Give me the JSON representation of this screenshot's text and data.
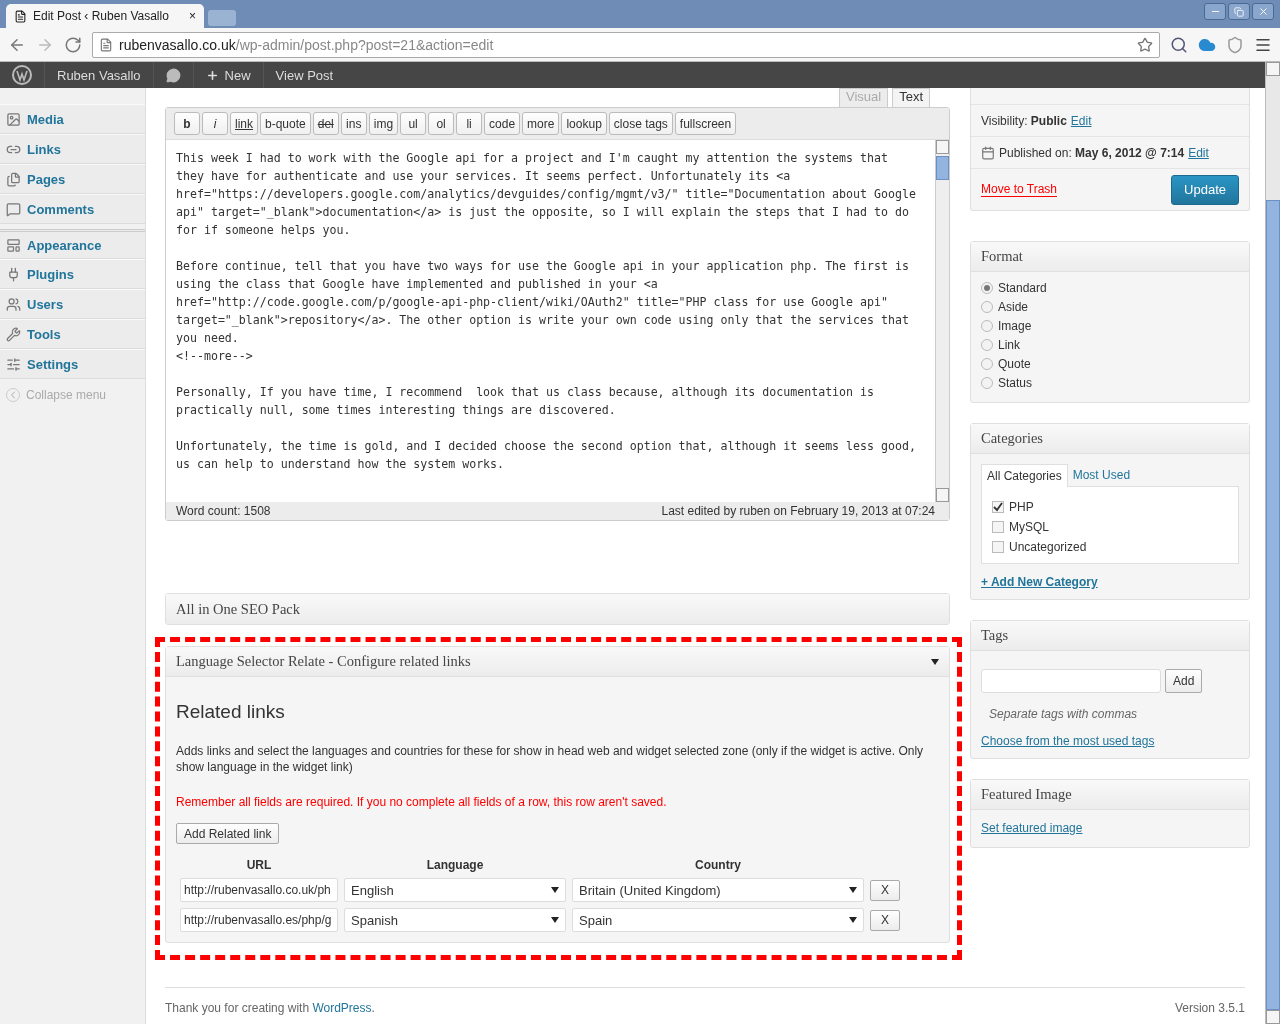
{
  "browser": {
    "tabs": [
      {
        "title": "Edit Post ‹ Ruben Vasallo",
        "close": "×",
        "selected": true
      }
    ],
    "url": {
      "host": "rubenvasallo.co.uk",
      "path": "/wp-admin/post.php?post=21&action=edit"
    }
  },
  "admin_bar": {
    "site": "Ruben Vasallo",
    "new": "New",
    "view": "View Post"
  },
  "sidebar": {
    "groups": [
      [
        {
          "label": "Media"
        },
        {
          "label": "Links"
        },
        {
          "label": "Pages"
        },
        {
          "label": "Comments"
        }
      ],
      [
        {
          "label": "Appearance"
        },
        {
          "label": "Plugins"
        },
        {
          "label": "Users"
        },
        {
          "label": "Tools"
        },
        {
          "label": "Settings"
        }
      ]
    ],
    "collapse": "Collapse menu"
  },
  "editor": {
    "tabs": [
      {
        "label": "Visual",
        "selected": false
      },
      {
        "label": "Text",
        "selected": true
      }
    ],
    "quicktags": [
      {
        "label": "b",
        "kind": "bold"
      },
      {
        "label": "i",
        "kind": "italic"
      },
      {
        "label": "link",
        "kind": "underline"
      },
      {
        "label": "b-quote",
        "kind": "plain"
      },
      {
        "label": "del",
        "kind": "strike"
      },
      {
        "label": "ins",
        "kind": "plain"
      },
      {
        "label": "img",
        "kind": "plain"
      },
      {
        "label": "ul",
        "kind": "plain"
      },
      {
        "label": "ol",
        "kind": "plain"
      },
      {
        "label": "li",
        "kind": "plain"
      },
      {
        "label": "code",
        "kind": "plain"
      },
      {
        "label": "more",
        "kind": "plain"
      },
      {
        "label": "lookup",
        "kind": "plain"
      },
      {
        "label": "close tags",
        "kind": "plain"
      },
      {
        "label": "fullscreen",
        "kind": "plain"
      }
    ],
    "paragraphs": [
      [
        "This week I had to work with the Google api for a project and I'm caught my attention the systems that",
        "they have for authenticate and use your services. It seems perfect. Unfortunately its <a",
        "href=\"https://developers.google.com/analytics/devguides/config/mgmt/v3/\" title=\"Documentation about Google",
        "api\" target=\"_blank\">documentation</a> is just the opposite, so I will explain the steps that I had to do",
        "for if someone helps you."
      ],
      [
        "Before continue, tell that you have two ways for use the Google api in your application php. The first is",
        "using the class that Google have implemented and published in your <a",
        "href=\"http://code.google.com/p/google-api-php-client/wiki/OAuth2\" title=\"PHP class for use Google api\"",
        "target=\"_blank\">repository</a>. The other option is write your own code using only that the services that",
        "you need.",
        "<!--more-->"
      ],
      [
        "Personally, If you have time, I recommend  look that us class because, although its documentation is",
        "practically null, some times interesting things are discovered."
      ],
      [
        "Unfortunately, the time is gold, and I decided choose the second option that, although it seems less good,",
        "us can help to understand how the system works."
      ]
    ],
    "word_count": "Word count: 1508",
    "last_edited": "Last edited by ruben on February 19, 2013 at 07:24"
  },
  "seo_panel": {
    "title": "All in One SEO Pack"
  },
  "language_panel": {
    "title": "Language Selector Relate - Configure related links",
    "heading": "Related links",
    "description": "Adds links and select the languages and countries for these for show in head web and widget selected zone (only if the widget is active. Only show language in the widget link)",
    "warning": "Remember all fields are required. If you no complete all fields of a row, this row aren't saved.",
    "add_button": "Add Related link",
    "columns": [
      "URL",
      "Language",
      "Country"
    ],
    "rows": [
      {
        "url": "http://rubenvasallo.co.uk/ph",
        "language": "English",
        "country": "Britain (United Kingdom)",
        "remove": "X"
      },
      {
        "url": "http://rubenvasallo.es/php/g",
        "language": "Spanish",
        "country": "Spain",
        "remove": "X"
      }
    ]
  },
  "publish": {
    "visibility": "Visibility: **Public**",
    "visibility_edit": "Edit",
    "published": "Published on: **May 6, 2012 @ 7:14**",
    "published_edit": "Edit",
    "trash": "Move to Trash",
    "update": "Update"
  },
  "format": {
    "title": "Format",
    "options": [
      {
        "label": "Standard",
        "selected": true
      },
      {
        "label": "Aside",
        "selected": false
      },
      {
        "label": "Image",
        "selected": false
      },
      {
        "label": "Link",
        "selected": false
      },
      {
        "label": "Quote",
        "selected": false
      },
      {
        "label": "Status",
        "selected": false
      }
    ]
  },
  "categories": {
    "title": "Categories",
    "tabs": [
      {
        "label": "All Categories",
        "selected": true
      },
      {
        "label": "Most Used",
        "selected": false
      }
    ],
    "items": [
      {
        "label": "PHP",
        "checked": true
      },
      {
        "label": "MySQL",
        "checked": false
      },
      {
        "label": "Uncategorized",
        "checked": false
      }
    ],
    "add_link": "+ Add New Category"
  },
  "tags": {
    "title": "Tags",
    "add": "Add",
    "hint": "Separate tags with commas",
    "link": "Choose from the most used tags"
  },
  "featured_image": {
    "title": "Featured Image",
    "link": "Set featured image"
  },
  "footer": {
    "before": "Thank you for creating with ",
    "link": "WordPress",
    "after": ".",
    "version": "Version 3.5.1"
  }
}
